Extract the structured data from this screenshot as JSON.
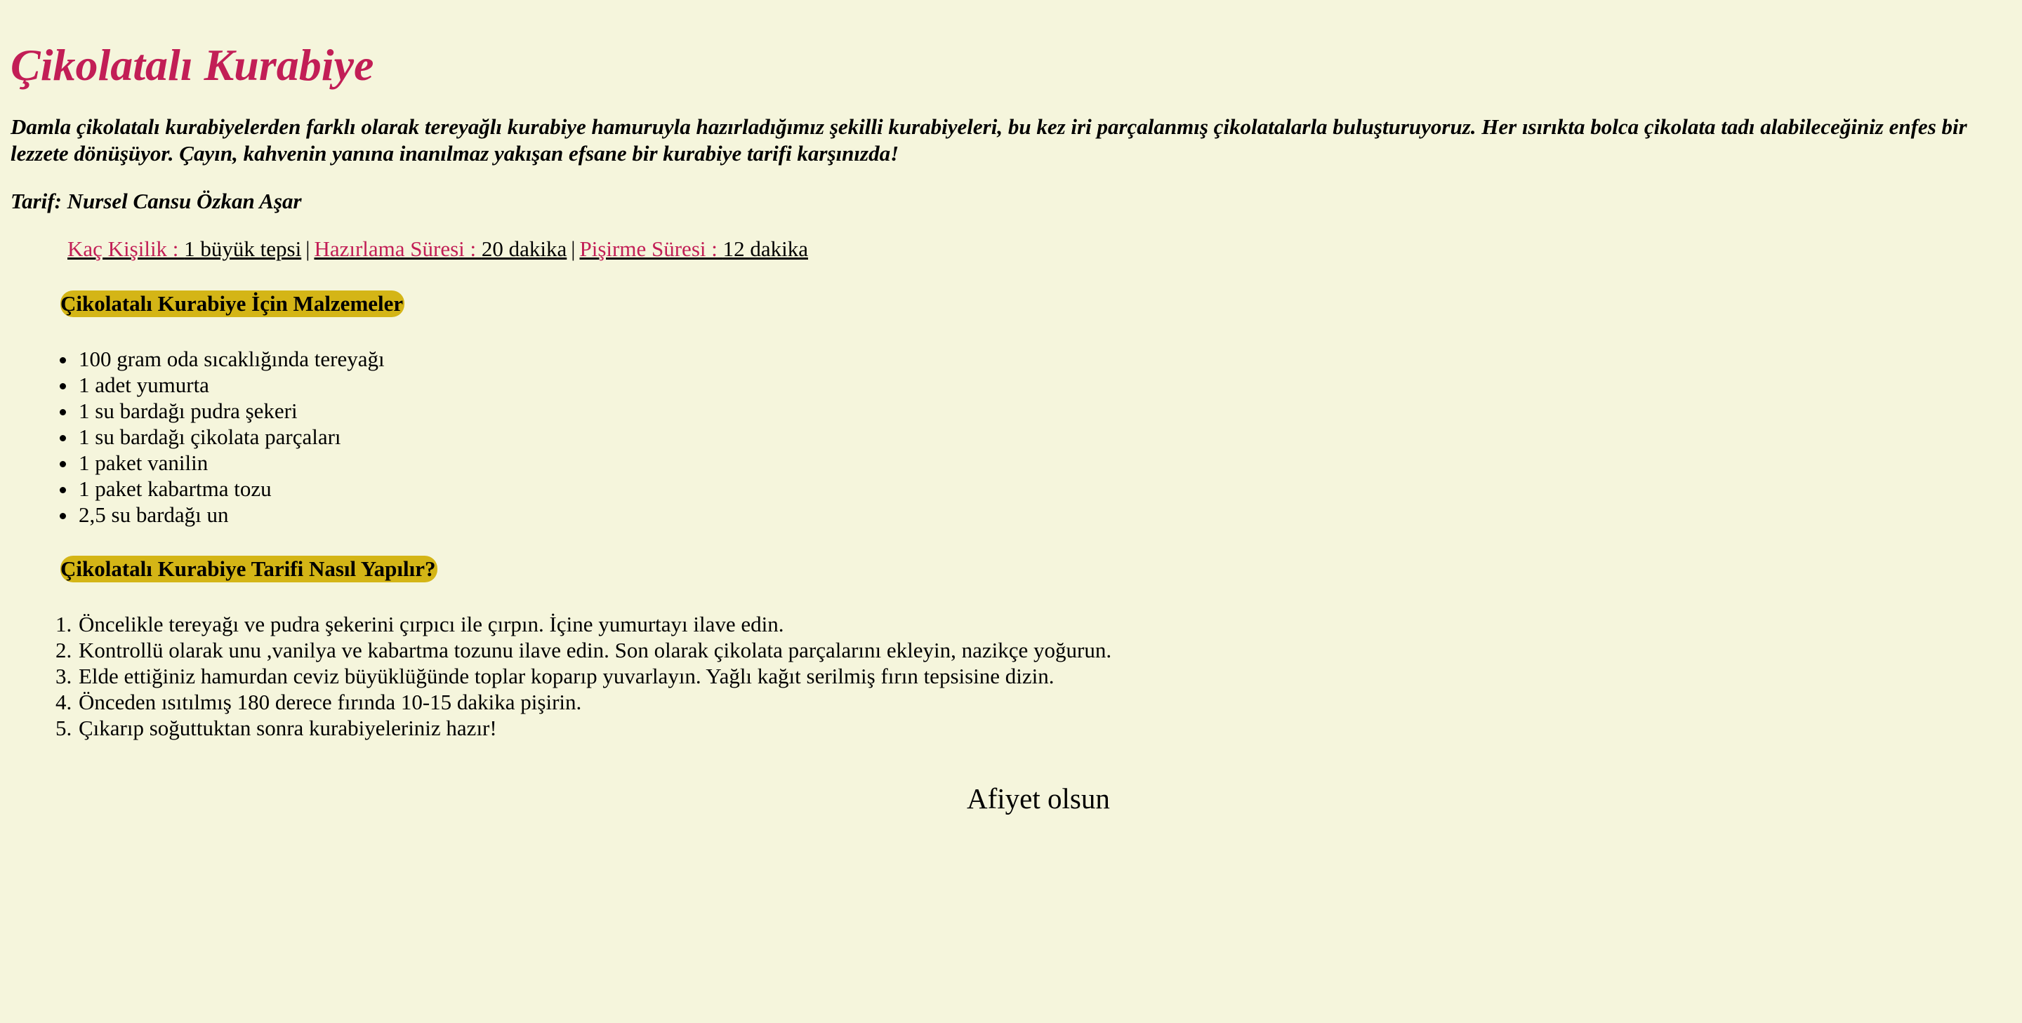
{
  "page": {
    "title": "Çikolatalı Kurabiye",
    "intro": "Damla çikolatalı kurabiyelerden farklı olarak tereyağlı kurabiye hamuruyla hazırladığımız şekilli kurabiyeleri, bu kez iri parçalanmış çikolatalarla buluşturuyoruz. Her ısırıkta bolca çikolata tadı alabileceğiniz enfes bir lezzete dönüşüyor. Çayın, kahvenin yanına inanılmaz yakışan efsane bir kurabiye tarifi karşınızda!",
    "author": "Tarif: Nursel Cansu Özkan Aşar"
  },
  "meta": {
    "servings_label": "Kaç Kişilik : ",
    "servings_value": "1 büyük tepsi",
    "prep_label": "Hazırlama Süresi : ",
    "prep_value": "20 dakika",
    "cook_label": "Pişirme Süresi : ",
    "cook_value": "12 dakika",
    "separator": "|"
  },
  "ingredients": {
    "heading": "Çikolatalı Kurabiye İçin Malzemeler",
    "items": [
      "100 gram oda sıcaklığında tereyağı",
      "1 adet yumurta",
      "1 su bardağı pudra şekeri",
      "1 su bardağı çikolata parçaları",
      "1 paket vanilin",
      "1 paket kabartma tozu",
      "2,5 su bardağı un"
    ]
  },
  "steps": {
    "heading": "Çikolatalı Kurabiye Tarifi Nasıl Yapılır?",
    "items": [
      "Öncelikle tereyağı ve pudra şekerini çırpıcı ile çırpın. İçine yumurtayı ilave edin.",
      "Kontrollü olarak unu ,vanilya ve kabartma tozunu ilave edin. Son olarak çikolata parçalarını ekleyin, nazikçe yoğurun.",
      "Elde ettiğiniz hamurdan ceviz büyüklüğünde toplar koparıp yuvarlayın. Yağlı kağıt serilmiş fırın tepsisine dizin.",
      "Önceden ısıtılmış 180 derece fırında 10-15 dakika pişirin.",
      "Çıkarıp soğuttuktan sonra kurabiyeleriniz hazır!"
    ]
  },
  "closing": "Afiyet olsun",
  "colors": {
    "background": "#f5f5dc",
    "accent": "#c21e56",
    "heading_highlight": "#d4b516"
  }
}
